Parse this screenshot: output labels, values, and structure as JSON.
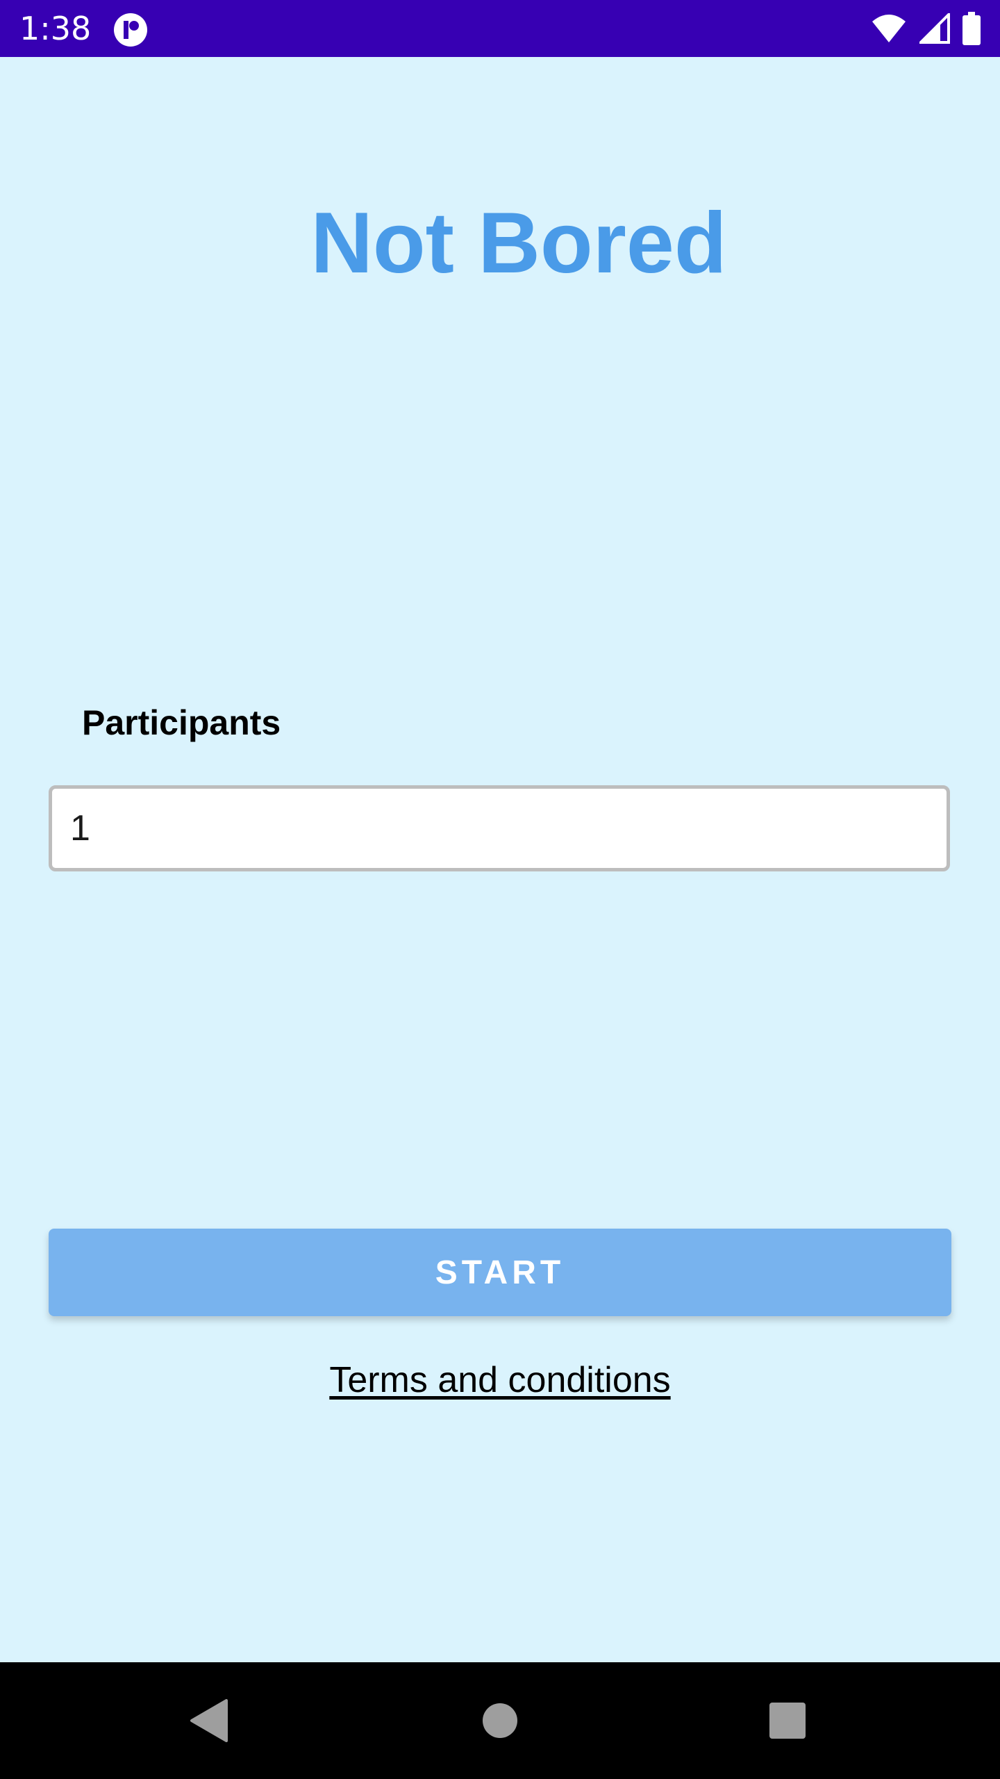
{
  "status_bar": {
    "time": "1:38",
    "icons": [
      "app-notification-icon",
      "wifi-icon",
      "cellular-signal-icon",
      "battery-icon"
    ],
    "color": "#3700b3"
  },
  "app": {
    "title": "Not Bored",
    "participants_label": "Participants",
    "participants_value": "1",
    "start_label": "START",
    "terms_label": "Terms and conditions",
    "colors": {
      "background": "#daf3fd",
      "title": "#4a9be8",
      "button": "#78b3ee"
    }
  },
  "nav_bar": {
    "buttons": [
      "back-icon",
      "home-icon",
      "recents-icon"
    ]
  }
}
